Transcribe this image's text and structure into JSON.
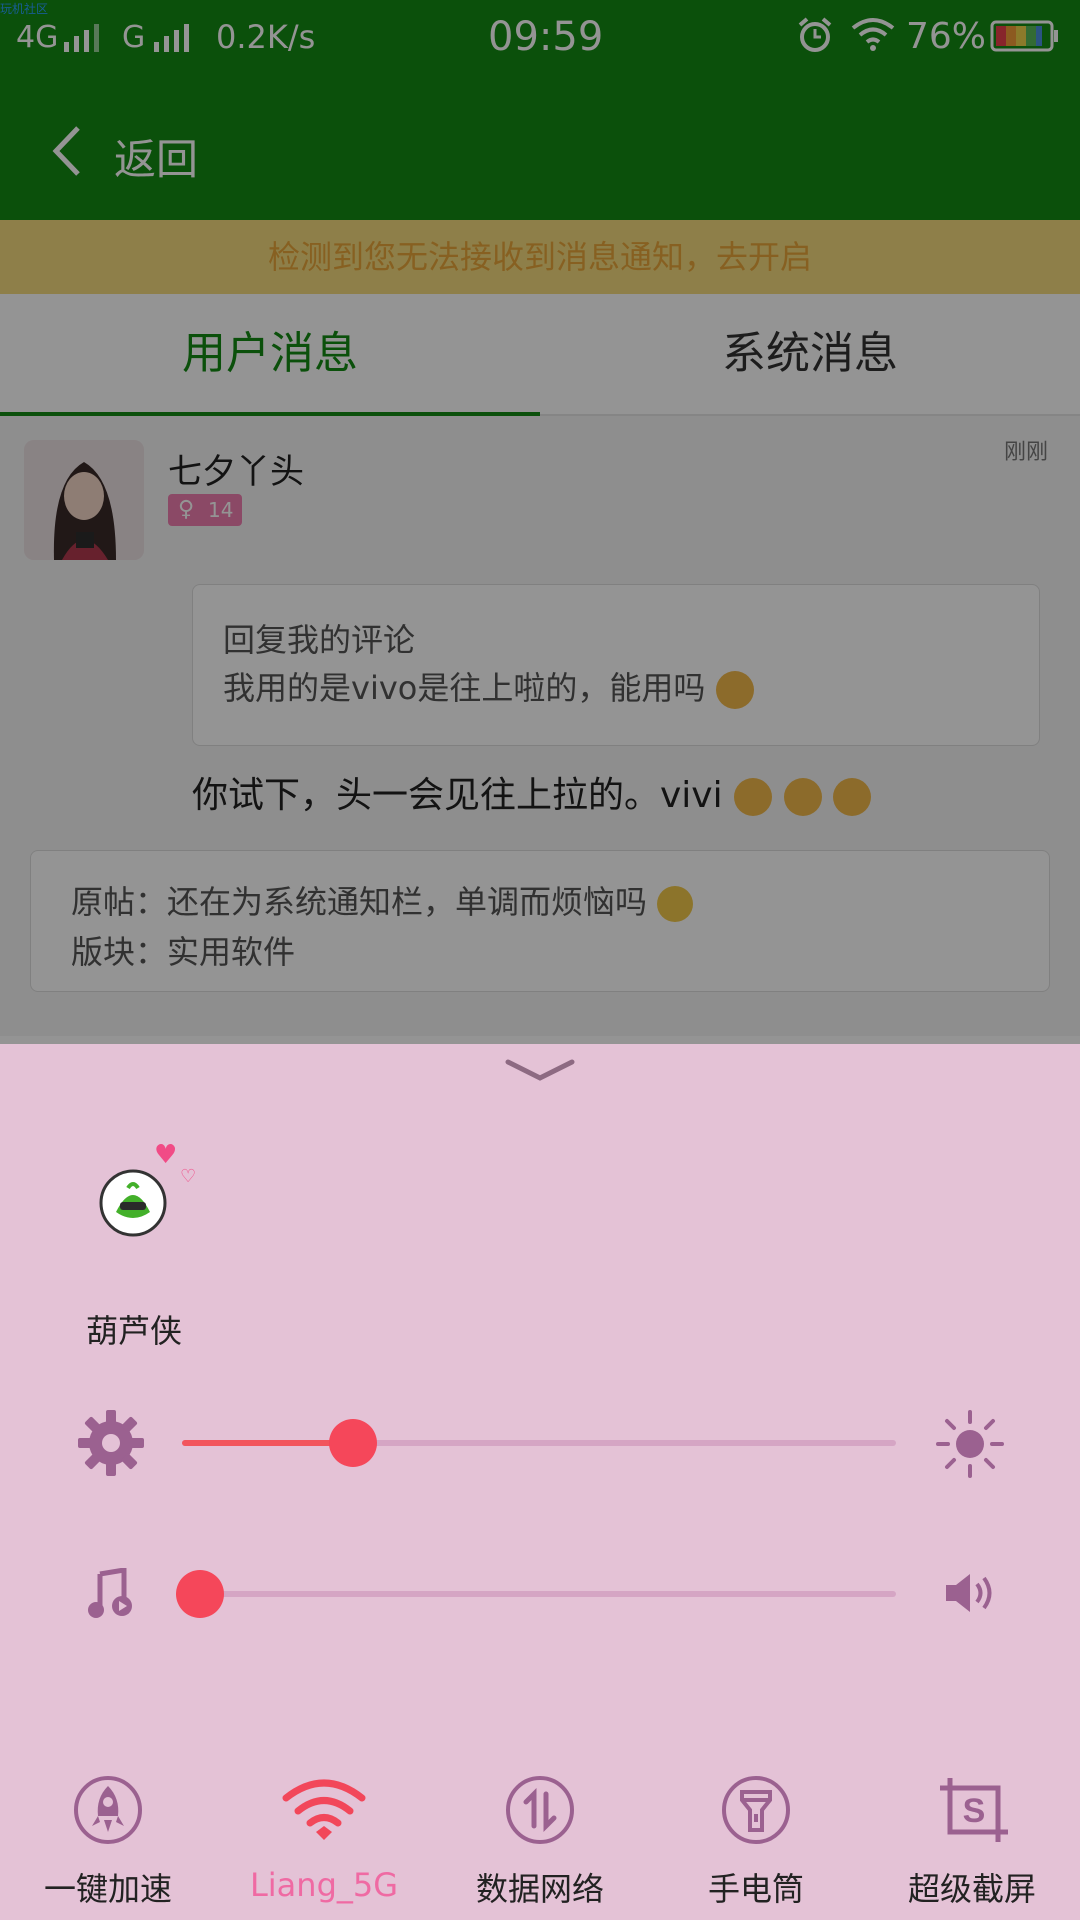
{
  "watermark": "玩机社区",
  "status_bar": {
    "network1": "4G",
    "network2": "G",
    "speed": "0.2K/s",
    "time": "09:59",
    "battery": "76%",
    "icons": [
      "signal-icon",
      "alarm-icon",
      "wifi-icon",
      "battery-icon"
    ]
  },
  "header": {
    "back_label": "返回"
  },
  "notice": {
    "text": "检测到您无法接收到消息通知，去开启"
  },
  "tabs": [
    {
      "label": "用户消息",
      "active": true
    },
    {
      "label": "系统消息",
      "active": false
    }
  ],
  "message": {
    "username": "七夕丫头",
    "level": "14",
    "time": "刚刚",
    "quote_line1": "回复我的评论",
    "quote_line2": "我用的是vivo是往上啦的，能用吗",
    "reply": "你试下，头一会见往上拉的。vivi",
    "post_line1": "原帖：还在为系统通知栏，单调而烦恼吗",
    "post_line2": "版块：实用软件"
  },
  "panel": {
    "app_name": "葫芦侠",
    "brightness_level": 0.24,
    "volume_level": 0.02,
    "tiles": [
      {
        "label": "一键加速",
        "icon": "rocket-icon"
      },
      {
        "label": "Liang_5G",
        "icon": "wifi-icon",
        "active": true
      },
      {
        "label": "数据网络",
        "icon": "data-arrows-icon"
      },
      {
        "label": "手电筒",
        "icon": "flashlight-icon"
      },
      {
        "label": "超级截屏",
        "icon": "screenshot-icon"
      }
    ]
  },
  "colors": {
    "app_green": "#138a13",
    "panel_bg": "#e4c2d6",
    "accent_red": "#f5475a",
    "active_label": "#ef6aa3",
    "icon_purple": "#9b6190"
  }
}
